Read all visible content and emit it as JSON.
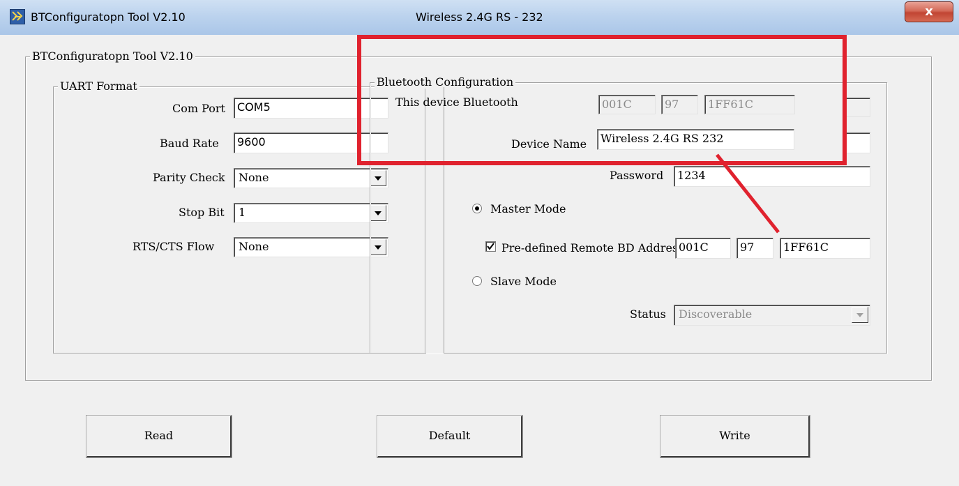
{
  "window": {
    "title": "BTConfiguratopn Tool V2.10",
    "device_title": "Wireless 2.4G RS - 232",
    "close_glyph": "x",
    "app_icon": "bluetooth-tool-icon"
  },
  "main_group": {
    "legend": "BTConfiguratopn Tool V2.10"
  },
  "uart": {
    "legend": "UART Format",
    "com_port_label": "Com Port",
    "com_port_value": "COM5",
    "baud_rate_label": "Baud Rate",
    "baud_rate_value": "9600",
    "parity_label": "Parity Check",
    "parity_value": "None",
    "stop_bit_label": "Stop Bit",
    "stop_bit_value": "1",
    "flow_label": "RTS/CTS Flow",
    "flow_value": "None"
  },
  "bluetooth": {
    "legend": "Bluetooth Configuration",
    "device_label": "This device Bluetooth",
    "addr_part1": "001C",
    "addr_part2": "97",
    "addr_part3": "1FF61C",
    "device_name_label": "Device Name",
    "device_name_value": "Wireless 2.4G RS 232",
    "password_label": "Password",
    "password_value": "1234",
    "master_mode_label": "Master Mode",
    "master_mode_selected": true,
    "predefined_label": "Pre-defined Remote BD Addres",
    "predefined_checked": true,
    "remote_part1": "001C",
    "remote_part2": "97",
    "remote_part3": "1FF61C",
    "slave_mode_label": "Slave Mode",
    "status_label": "Status",
    "status_value": "Discoverable"
  },
  "buttons": {
    "read": "Read",
    "default": "Default",
    "write": "Write"
  },
  "annotation": {
    "color": "#e0222e"
  }
}
